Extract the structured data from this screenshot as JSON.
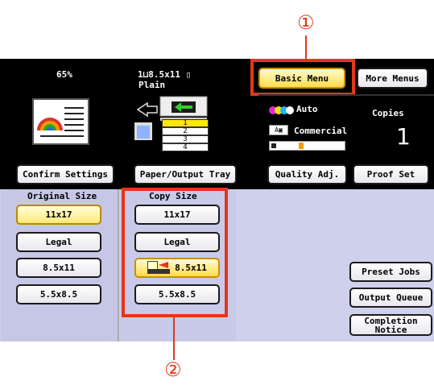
{
  "colors": {
    "accent": "#e4361a",
    "panel": "#000000",
    "lower_panel": "#cfd0ec",
    "selected": "#ffe97a"
  },
  "callouts": {
    "one": "①",
    "two": "②"
  },
  "status": {
    "zoom": "65%",
    "paper_size": "1⊔8.5x11 ▯",
    "paper_type": "Plain"
  },
  "tray_numbers": [
    "1",
    "2",
    "3",
    "4"
  ],
  "tabs": {
    "basic": "Basic Menu",
    "more": "More Menus"
  },
  "quality": {
    "color_mode": "Auto",
    "image_mode": "Commercial",
    "copies_label": "Copies",
    "copies_value": "1"
  },
  "buttons": {
    "confirm": "Confirm Settings",
    "paper_tray": "Paper/Output Tray",
    "quality_adj": "Quality Adj.",
    "proof_set": "Proof Set"
  },
  "original_size": {
    "label": "Original Size",
    "items": [
      "11x17",
      "Legal",
      "8.5x11",
      "5.5x8.5"
    ]
  },
  "copy_size": {
    "label": "Copy Size",
    "items": [
      "11x17",
      "Legal",
      "8.5x11",
      "5.5x8.5"
    ]
  },
  "jobs": {
    "preset": "Preset Jobs",
    "queue": "Output Queue",
    "completion_line1": "Completion",
    "completion_line2": "Notice"
  }
}
